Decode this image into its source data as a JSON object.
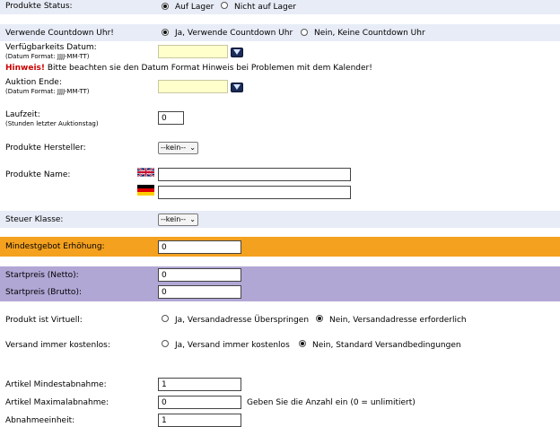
{
  "status": {
    "label": "Produkte Status:",
    "opt_on": "Auf Lager",
    "opt_off": "Nicht auf Lager"
  },
  "countdown": {
    "label": "Verwende Countdown Uhr!",
    "opt_yes": "Ja, Verwende Countdown Uhr",
    "opt_no": "Nein, Keine Countdown Uhr"
  },
  "avail": {
    "label": "Verfügbarkeits Datum:",
    "hint": "(Datum Format: JJJJ-MM-TT)",
    "value": ""
  },
  "warning": {
    "bold": "Hinweis!",
    "text": "Bitte beachten sie den Datum Format Hinweis bei Problemen mit dem Kalender!"
  },
  "auction_end": {
    "label": "Auktion Ende:",
    "hint": "(Datum Format: JJJJ-MM-TT)",
    "value": ""
  },
  "runtime": {
    "label": "Laufzeit:",
    "hint": "(Stunden letzter Auktionstag)",
    "value": "0"
  },
  "manufacturer": {
    "label": "Produkte Hersteller:",
    "value": "--kein--"
  },
  "product_name": {
    "label": "Produkte Name:",
    "en_value": "",
    "de_value": ""
  },
  "tax": {
    "label": "Steuer Klasse:",
    "value": "--kein--"
  },
  "min_increase": {
    "label": "Mindestgebot Erhöhung:",
    "value": "0"
  },
  "start_net": {
    "label": "Startpreis (Netto):",
    "value": "0"
  },
  "start_gross": {
    "label": "Startpreis (Brutto):",
    "value": "0"
  },
  "virtual": {
    "label": "Produkt ist Virtuell:",
    "opt_yes": "Ja, Versandadresse Überspringen",
    "opt_no": "Nein, Versandadresse erforderlich"
  },
  "free_ship": {
    "label": "Versand immer kostenlos:",
    "opt_yes": "Ja, Versand immer kostenlos",
    "opt_no": "Nein, Standard Versandbedingungen"
  },
  "min_qty": {
    "label": "Artikel Mindestabnahme:",
    "value": "1"
  },
  "max_qty": {
    "label": "Artikel Maximalabnahme:",
    "value": "0",
    "hint": "Geben Sie die Anzahl ein (0 = unlimitiert)"
  },
  "unit": {
    "label": "Abnahmeeinheit:",
    "value": "1"
  },
  "colors": {
    "blue_band": "#e8ecf7",
    "orange_band": "#f4a11f",
    "purple_band": "#b1a7d5",
    "date_bg": "#ffffcc",
    "warning_red": "#cc0000"
  }
}
